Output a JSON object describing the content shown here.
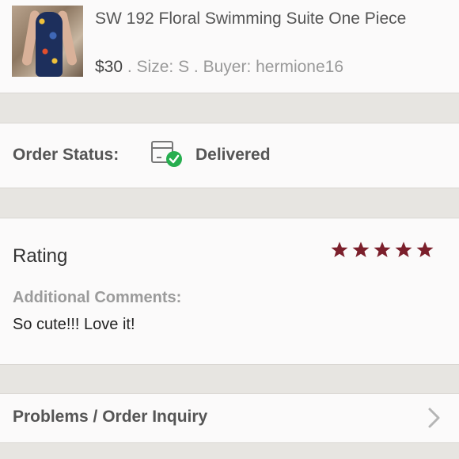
{
  "product": {
    "title": "SW 192 Floral Swimming Suite One Piece",
    "price": "$30",
    "meta": " . Size: S . Buyer: hermione16"
  },
  "order_status": {
    "label": "Order Status:",
    "value": "Delivered",
    "icon": "delivered-box-icon",
    "check_color": "#27ae4f"
  },
  "rating": {
    "title": "Rating",
    "stars": 5,
    "star_color": "#7b1f2b",
    "comments_label": "Additional Comments:",
    "comment": "So cute!!! Love it!"
  },
  "inquiry": {
    "label": "Problems / Order Inquiry",
    "icon": "chevron-right-icon"
  }
}
